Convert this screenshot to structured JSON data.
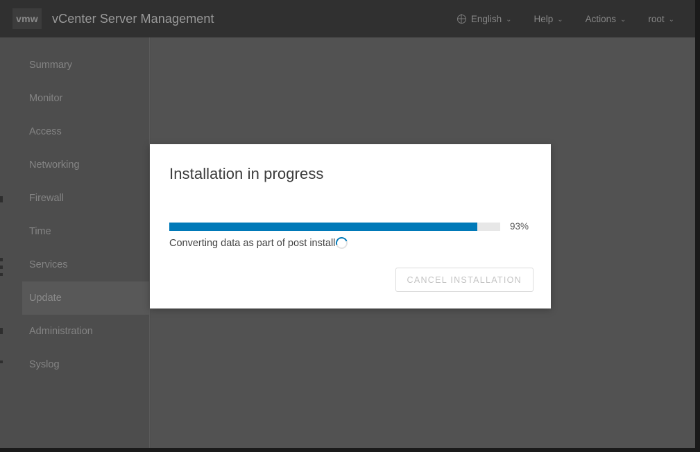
{
  "header": {
    "logo_text": "vmw",
    "title": "vCenter Server Management",
    "menu": [
      {
        "label": "English",
        "icon": "globe-icon",
        "caret": "⌄"
      },
      {
        "label": "Help",
        "icon": null,
        "caret": "⌄"
      },
      {
        "label": "Actions",
        "icon": null,
        "caret": "⌄"
      },
      {
        "label": "root",
        "icon": null,
        "caret": "⌄"
      }
    ]
  },
  "sidebar": {
    "items": [
      {
        "label": "Summary",
        "active": false
      },
      {
        "label": "Monitor",
        "active": false
      },
      {
        "label": "Access",
        "active": false
      },
      {
        "label": "Networking",
        "active": false
      },
      {
        "label": "Firewall",
        "active": false
      },
      {
        "label": "Time",
        "active": false
      },
      {
        "label": "Services",
        "active": false
      },
      {
        "label": "Update",
        "active": true
      },
      {
        "label": "Administration",
        "active": false
      },
      {
        "label": "Syslog",
        "active": false
      }
    ]
  },
  "modal": {
    "title": "Installation in progress",
    "progress_percent_label": "93%",
    "progress_percent_value": 93,
    "status_text": "Converting data as part of post install",
    "spinner_icon": "loading-spinner-icon",
    "cancel_label": "CANCEL INSTALLATION",
    "cancel_disabled": true
  },
  "colors": {
    "accent_blue": "#0079b8",
    "header_bg": "#303030",
    "sidebar_bg": "#4d4d4d",
    "content_bg": "#525252",
    "modal_bg": "#ffffff",
    "track_bg": "#e7e7e7"
  }
}
